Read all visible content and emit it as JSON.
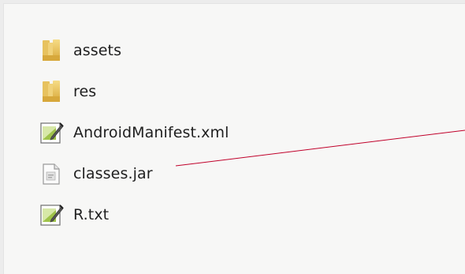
{
  "files": [
    {
      "name": "assets",
      "icon": "folder-icon"
    },
    {
      "name": "res",
      "icon": "folder-icon"
    },
    {
      "name": "AndroidManifest.xml",
      "icon": "xml-file-icon"
    },
    {
      "name": "classes.jar",
      "icon": "jar-file-icon"
    },
    {
      "name": "R.txt",
      "icon": "text-file-icon"
    }
  ],
  "colors": {
    "background": "#f7f7f6",
    "annotation_line": "#c0002a",
    "folder": "#e8c25a"
  }
}
